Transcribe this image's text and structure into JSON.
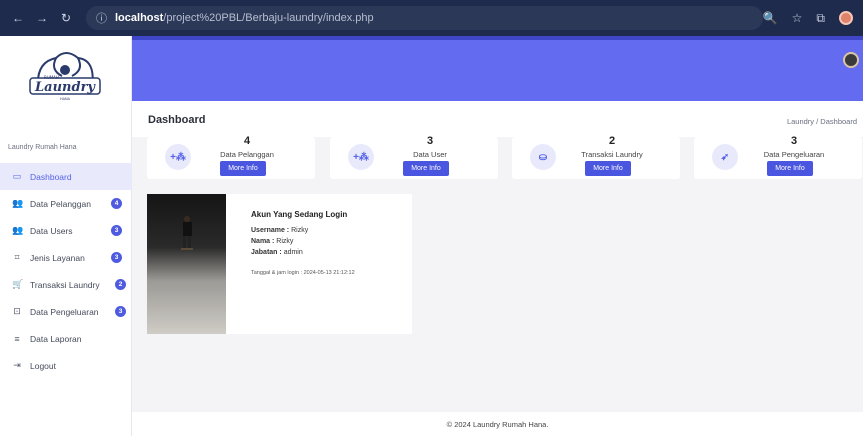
{
  "browser": {
    "url_host": "localhost",
    "url_path": "/project%20PBL/Berbaju-laundry/index.php"
  },
  "sidebar": {
    "caption": "Laundry Rumah Hana",
    "items": [
      {
        "label": "Dashboard",
        "icon": "monitor-icon",
        "badge": ""
      },
      {
        "label": "Data Pelanggan",
        "icon": "users-icon",
        "badge": "4"
      },
      {
        "label": "Data Users",
        "icon": "users-icon",
        "badge": "3"
      },
      {
        "label": "Jenis Layanan",
        "icon": "layers-icon",
        "badge": "3"
      },
      {
        "label": "Transaksi Laundry",
        "icon": "cart-icon",
        "badge": "2"
      },
      {
        "label": "Data Pengeluaran",
        "icon": "wallet-icon",
        "badge": "3"
      },
      {
        "label": "Data Laporan",
        "icon": "list-icon",
        "badge": ""
      },
      {
        "label": "Logout",
        "icon": "logout-icon",
        "badge": ""
      }
    ]
  },
  "header": {
    "title": "Dashboard",
    "breadcrumb": "Laundry  /  Dashboard"
  },
  "cards": [
    {
      "value": "4",
      "label": "Data Pelanggan",
      "button": "More Info",
      "icon": "users-add-icon"
    },
    {
      "value": "3",
      "label": "Data User",
      "button": "More Info",
      "icon": "users-add-icon"
    },
    {
      "value": "2",
      "label": "Transaksi Laundry",
      "button": "More Info",
      "icon": "basket-icon"
    },
    {
      "value": "3",
      "label": "Data Pengeluaran",
      "button": "More Info",
      "icon": "rocket-icon"
    }
  ],
  "login": {
    "title": "Akun Yang Sedang Login",
    "username_label": "Username :",
    "username": "Rizky",
    "nama_label": "Nama :",
    "nama": "Rizky",
    "jabatan_label": "Jabatan :",
    "jabatan": "admin",
    "time": "Tanggal & jam login : 2024-05-13 21:12:12"
  },
  "footer": "© 2024 Laundry Rumah Hana.",
  "colors": {
    "accent": "#636bf0",
    "button": "#4a55e0",
    "active_bg": "#e8eafc"
  }
}
